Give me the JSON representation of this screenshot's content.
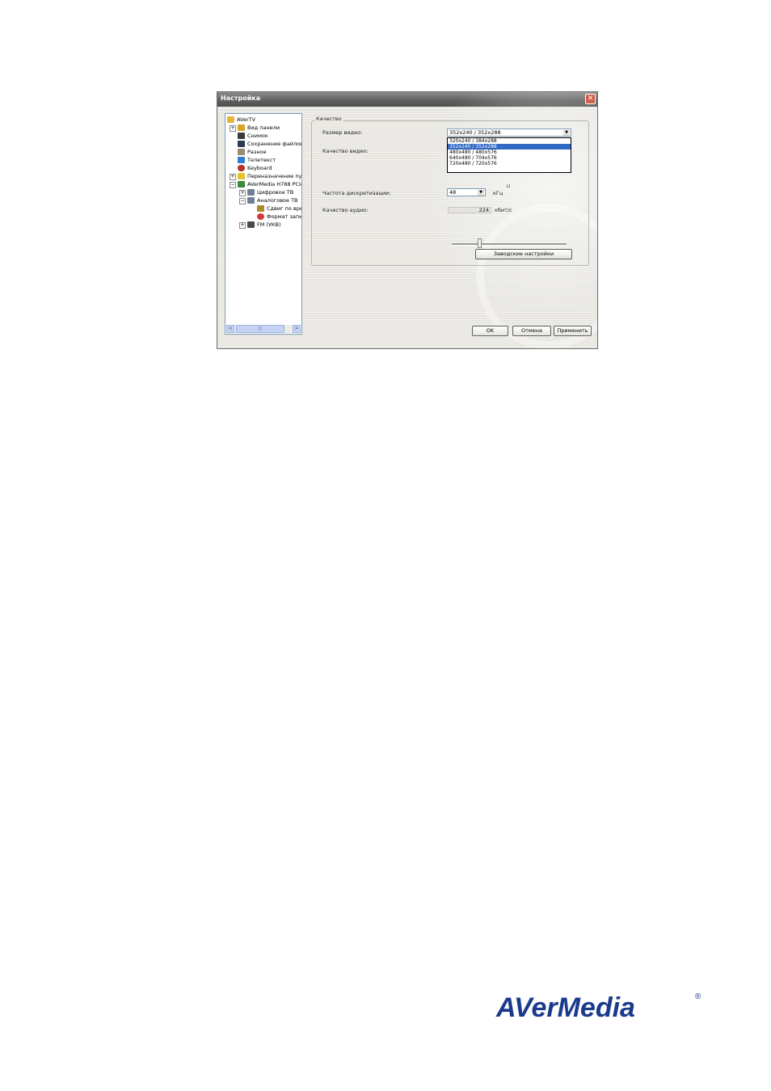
{
  "dialog": {
    "title": "Настройка",
    "close_label": "✕"
  },
  "tree": {
    "items": [
      {
        "label": "AVerTV"
      },
      {
        "label": "Вид панели"
      },
      {
        "label": "Снимок"
      },
      {
        "label": "Сохранение файлов"
      },
      {
        "label": "Разное"
      },
      {
        "label": "Телетекст"
      },
      {
        "label": "Keyboard"
      },
      {
        "label": "Переназначение пул"
      },
      {
        "label": "AVerMedia H788 PCIe"
      },
      {
        "label": "Цифровое ТВ"
      },
      {
        "label": "Аналоговое ТВ"
      },
      {
        "label": "Сдвиг по вре"
      },
      {
        "label": "Формат запи"
      },
      {
        "label": "FM (УКВ)"
      }
    ],
    "scrollbar_left": "<",
    "scrollbar_right": ">",
    "scrollbar_grip": "|||"
  },
  "quality": {
    "group_label": "Качество",
    "video_size_label": "Размер видео:",
    "video_size_value": "352x240 / 352x288",
    "video_size_options": [
      "320x240 / 384x288",
      "352x240 / 352x288",
      "480x480 / 480x576",
      "640x480 / 704x576",
      "720x480 / 720x576"
    ],
    "video_size_selected_index": 1,
    "video_quality_label": "Качество видео:",
    "sample_rate_label": "Частота дискретизации:",
    "sample_rate_value": "48",
    "sample_rate_unit": "кГц",
    "audio_quality_label": "Качество аудио:",
    "audio_quality_value": "224",
    "audio_quality_unit": "кбит/с",
    "audio_slider_position": 0.24,
    "defaults_button": "Заводские настройки"
  },
  "buttons": {
    "ok": "OK",
    "cancel": "Отмена",
    "apply": "Применить"
  },
  "logo": {
    "text": "AVerMedia",
    "registered": "®",
    "color": "#1a3a8c"
  }
}
